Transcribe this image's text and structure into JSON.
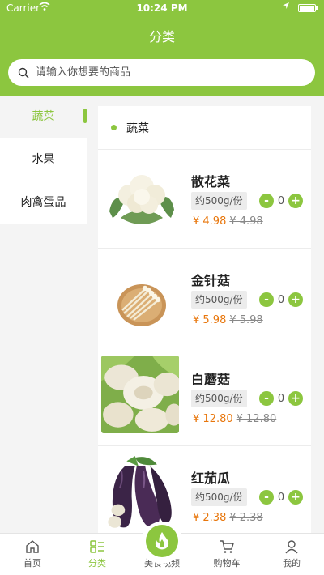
{
  "status_bar": {
    "carrier": "Carrier",
    "time": "10:24 PM"
  },
  "header": {
    "title": "分类"
  },
  "search": {
    "placeholder": "请输入你想要的商品"
  },
  "sidebar": {
    "items": [
      {
        "label": "蔬菜",
        "active": true
      },
      {
        "label": "水果",
        "active": false
      },
      {
        "label": "肉禽蛋品",
        "active": false
      }
    ]
  },
  "category": {
    "title": "蔬菜"
  },
  "products": [
    {
      "name": "散花菜",
      "spec": "约500g/份",
      "price": "¥ 4.98",
      "old_price": "¥ 4.98",
      "qty": "0",
      "image": "cauliflower"
    },
    {
      "name": "金针菇",
      "spec": "约500g/份",
      "price": "¥ 5.98",
      "old_price": "¥ 5.98",
      "qty": "0",
      "image": "enoki-mushroom"
    },
    {
      "name": "白蘑菇",
      "spec": "约500g/份",
      "price": "¥ 12.80",
      "old_price": "¥ 12.80",
      "qty": "0",
      "image": "white-mushroom"
    },
    {
      "name": "红茄瓜",
      "spec": "约500g/份",
      "price": "¥ 2.38",
      "old_price": "¥ 2.38",
      "qty": "0",
      "image": "eggplant"
    }
  ],
  "stepper": {
    "minus": "-",
    "plus": "+"
  },
  "tabbar": {
    "items": [
      {
        "label": "首页",
        "icon": "home-icon",
        "active": false
      },
      {
        "label": "分类",
        "icon": "category-icon",
        "active": true
      },
      {
        "label": "美食视频",
        "icon": "flame-icon",
        "active": false
      },
      {
        "label": "购物车",
        "icon": "cart-icon",
        "active": false
      },
      {
        "label": "我的",
        "icon": "user-icon",
        "active": false
      }
    ]
  },
  "colors": {
    "accent": "#8cc63f",
    "price": "#e8760b"
  }
}
